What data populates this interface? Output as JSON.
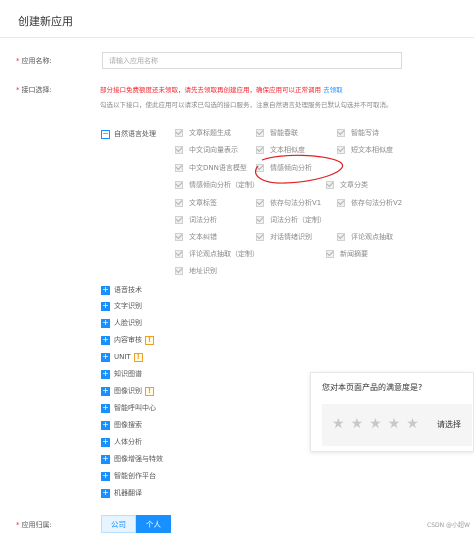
{
  "page": {
    "title": "创建新应用"
  },
  "app_name": {
    "label": "应用名称:",
    "placeholder": "请输入应用名称"
  },
  "api_select": {
    "label": "接口选择:",
    "warning": "部分接口免费额度还未领取，请先去领取再创建应用，确保应用可以正常调用",
    "warning_link": "去领取",
    "hint": "勾选以下接口，使此应用可以请求已勾选的接口服务，注意自然语言处理服务已默认勾选并不可取消。"
  },
  "nlp": {
    "label": "自然语言处理",
    "apis": [
      "文章标题生成",
      "智能春联",
      "智能写诗",
      "中文词向量表示",
      "文本相似度",
      "短文本相似度",
      "中文DNN语言模型",
      "情感倾向分析",
      "情感倾向分析（定制）",
      "文章分类",
      "文章标签",
      "依存句法分析V1",
      "依存句法分析V2",
      "词法分析",
      "词法分析（定制）",
      "文本纠错",
      "对话情绪识别",
      "评论观点抽取",
      "评论观点抽取（定制）",
      "新闻摘要",
      "地址识别"
    ]
  },
  "categories": [
    {
      "label": "语音技术",
      "warn": false
    },
    {
      "label": "文字识别",
      "warn": false
    },
    {
      "label": "人脸识别",
      "warn": false
    },
    {
      "label": "内容审核",
      "warn": true
    },
    {
      "label": "UNIT",
      "warn": true
    },
    {
      "label": "知识图谱",
      "warn": false
    },
    {
      "label": "图像识别",
      "warn": true
    },
    {
      "label": "智能呼叫中心",
      "warn": false
    },
    {
      "label": "图像搜索",
      "warn": false
    },
    {
      "label": "人体分析",
      "warn": false
    },
    {
      "label": "图像增强与特效",
      "warn": false
    },
    {
      "label": "智能创作平台",
      "warn": false
    },
    {
      "label": "机器翻译",
      "warn": false
    }
  ],
  "warn_mark": "!",
  "collapse_mark": "−",
  "expand_mark": "+",
  "survey": {
    "question": "您对本页面产品的满意度是?",
    "choose": "请选择",
    "star": "★"
  },
  "ownership": {
    "label": "应用归属:",
    "company": "公司",
    "personal": "个人"
  },
  "watermark": "CSDN @小超W",
  "colors": {
    "accent": "#1890ff",
    "warning": "#f5222d",
    "annotation": "#e02020"
  }
}
